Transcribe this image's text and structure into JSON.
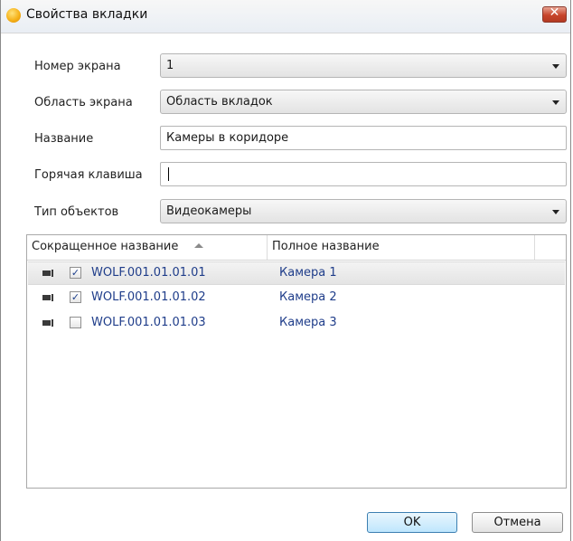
{
  "window": {
    "title": "Свойства вкладки",
    "close_glyph": "✕"
  },
  "form": {
    "screen_number": {
      "label": "Номер экрана",
      "value": "1"
    },
    "screen_area": {
      "label": "Область экрана",
      "value": "Область вкладок"
    },
    "name": {
      "label": "Название",
      "value": "Камеры в коридоре"
    },
    "hotkey": {
      "label": "Горячая клавиша",
      "value": ""
    },
    "object_type": {
      "label": "Тип объектов",
      "value": "Видеокамеры"
    }
  },
  "grid": {
    "columns": [
      "Сокращенное название",
      "Полное название"
    ],
    "sort_column": "Сокращенное название",
    "sort_direction": "ascending",
    "rows": [
      {
        "icon": "camera-icon",
        "checked": true,
        "short_name": "WOLF.001.01.01.01",
        "full_name": "Камера 1",
        "selected": true
      },
      {
        "icon": "camera-icon",
        "checked": true,
        "short_name": "WOLF.001.01.01.02",
        "full_name": "Камера 2",
        "selected": false
      },
      {
        "icon": "camera-icon",
        "checked": false,
        "short_name": "WOLF.001.01.01.03",
        "full_name": "Камера 3",
        "selected": false
      }
    ]
  },
  "buttons": {
    "ok": "OK",
    "cancel": "Отмена"
  },
  "colors": {
    "link_text": "#1f3d8a",
    "close_button": "#c7452b",
    "default_button": "#bee6fd"
  }
}
